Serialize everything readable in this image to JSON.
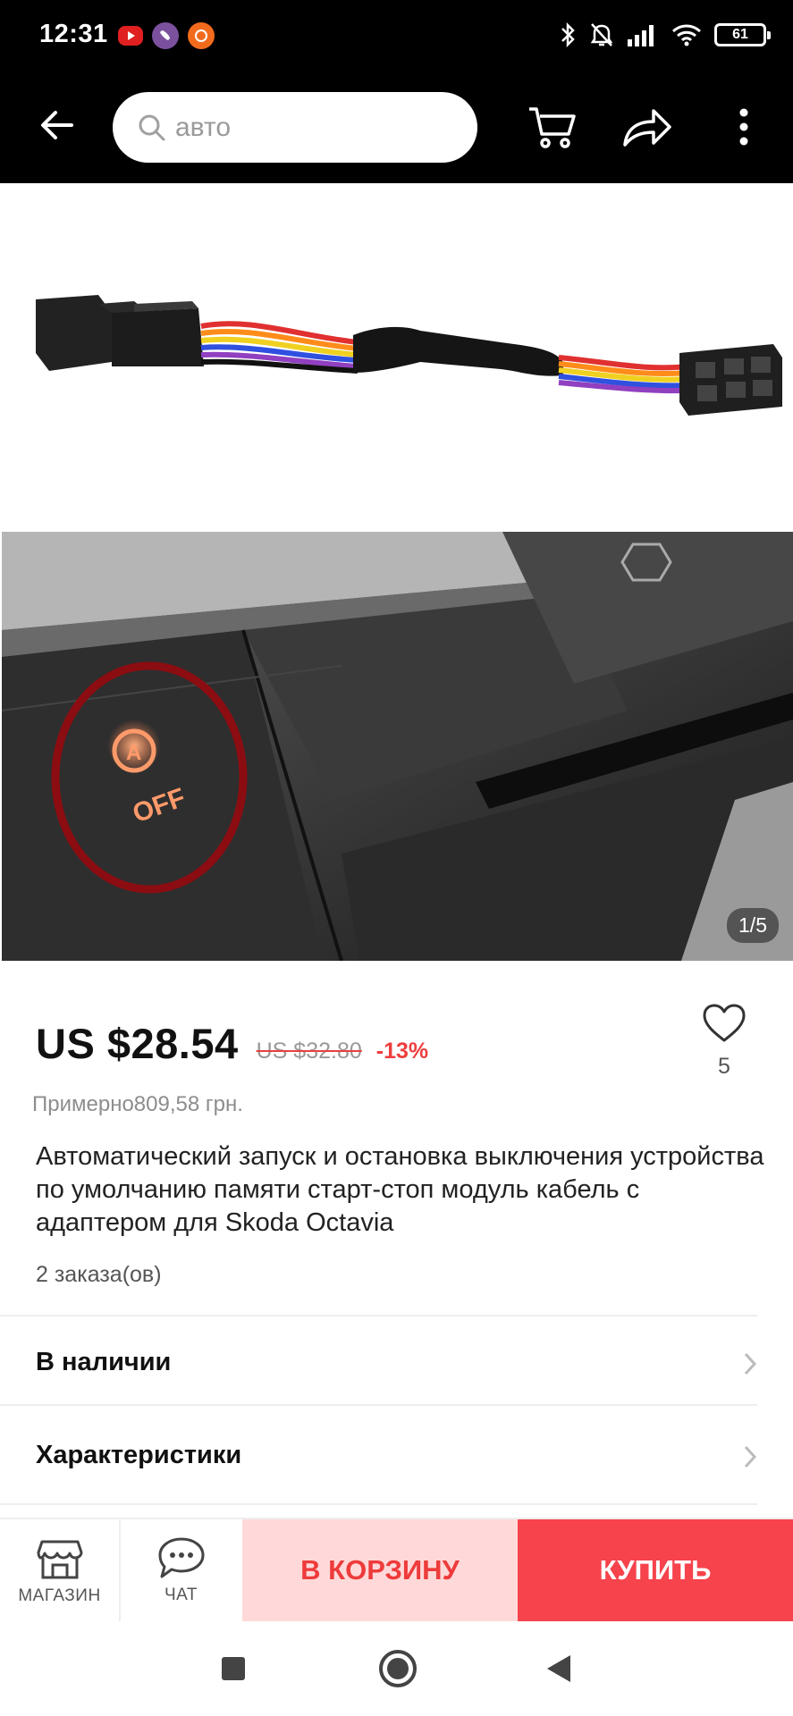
{
  "status_bar": {
    "time": "12:31",
    "battery": "61",
    "notification_icons": [
      "youtube-icon",
      "viber-icon",
      "aliexpress-icon"
    ],
    "system_icons": [
      "bluetooth-icon",
      "silent-icon",
      "signal-icon",
      "wifi-icon",
      "battery-icon"
    ]
  },
  "toolbar": {
    "search_placeholder": "авто",
    "icons": [
      "back-arrow-icon",
      "search-icon",
      "cart-icon",
      "share-icon",
      "more-icon"
    ]
  },
  "gallery": {
    "page_indicator": "1/5",
    "overlay_text": "OFF"
  },
  "product": {
    "price": "US $28.54",
    "old_price": "US $32.80",
    "discount": "-13%",
    "wishlist_count": "5",
    "approx_price": "Примерно809,58 грн.",
    "title": "Автоматический запуск и остановка выключения устройства по умолчанию памяти старт-стоп модуль кабель с адаптером для Skoda Octavia",
    "orders": "2 заказа(ов)"
  },
  "rows": {
    "availability": "В наличии",
    "specs": "Характеристики"
  },
  "action_bar": {
    "store_label": "МАГАЗИН",
    "chat_label": "ЧАТ",
    "add_to_cart": "В КОРЗИНУ",
    "buy": "КУПИТЬ"
  },
  "colors": {
    "accent": "#f6434c",
    "cart_bg": "#ffd9d9",
    "discount": "#ee3e3e"
  }
}
